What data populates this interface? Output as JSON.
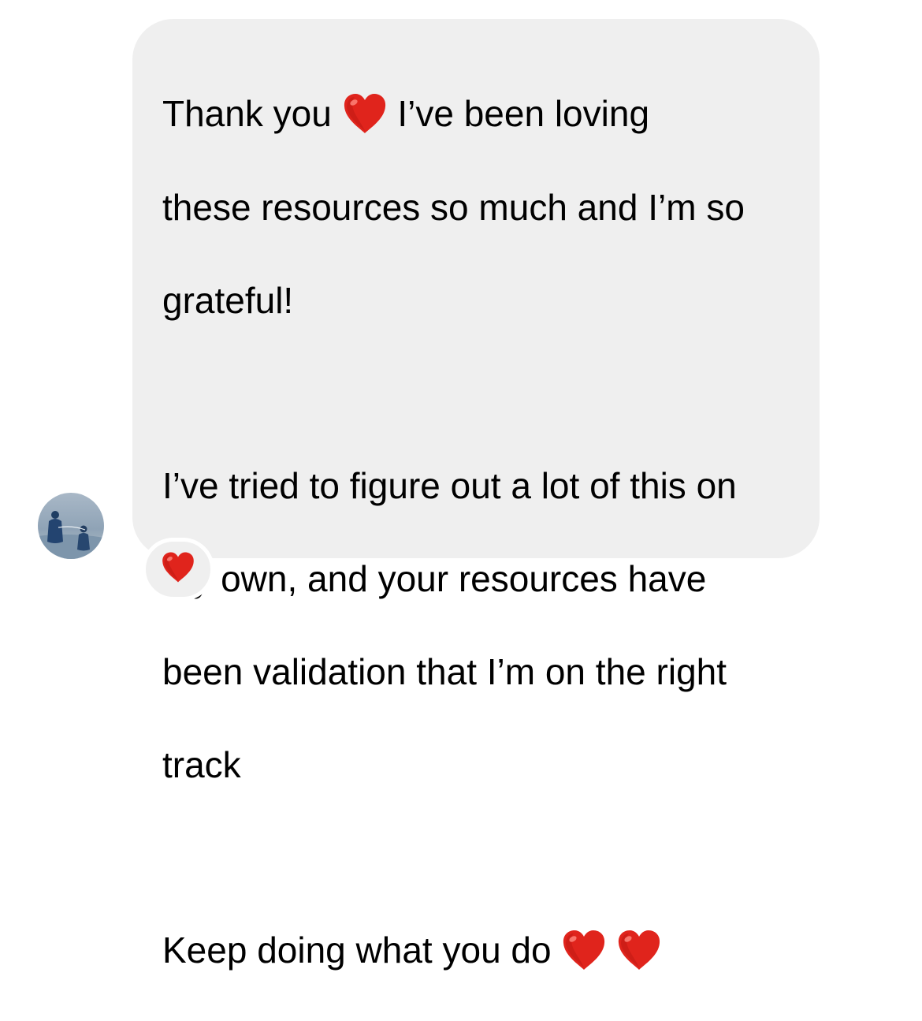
{
  "message": {
    "paragraph1": {
      "line1_before": "Thank you",
      "line1_after": "I’ve been loving",
      "line2": "these resources so much and I’m so",
      "line3": "grateful!"
    },
    "paragraph2": {
      "line1": "I’ve tried to figure out a lot of this on",
      "line2": "my own, and your resources have",
      "line3": "been validation that I’m on the right",
      "line4": "track"
    },
    "paragraph3": {
      "line1": "Keep doing what you do"
    }
  },
  "colors": {
    "bubble": "#efefef",
    "heart": "#e0241c"
  },
  "icons": {
    "inline_heart": "red-heart-emoji",
    "reaction": "red-heart-emoji",
    "avatar": "sender-avatar"
  }
}
